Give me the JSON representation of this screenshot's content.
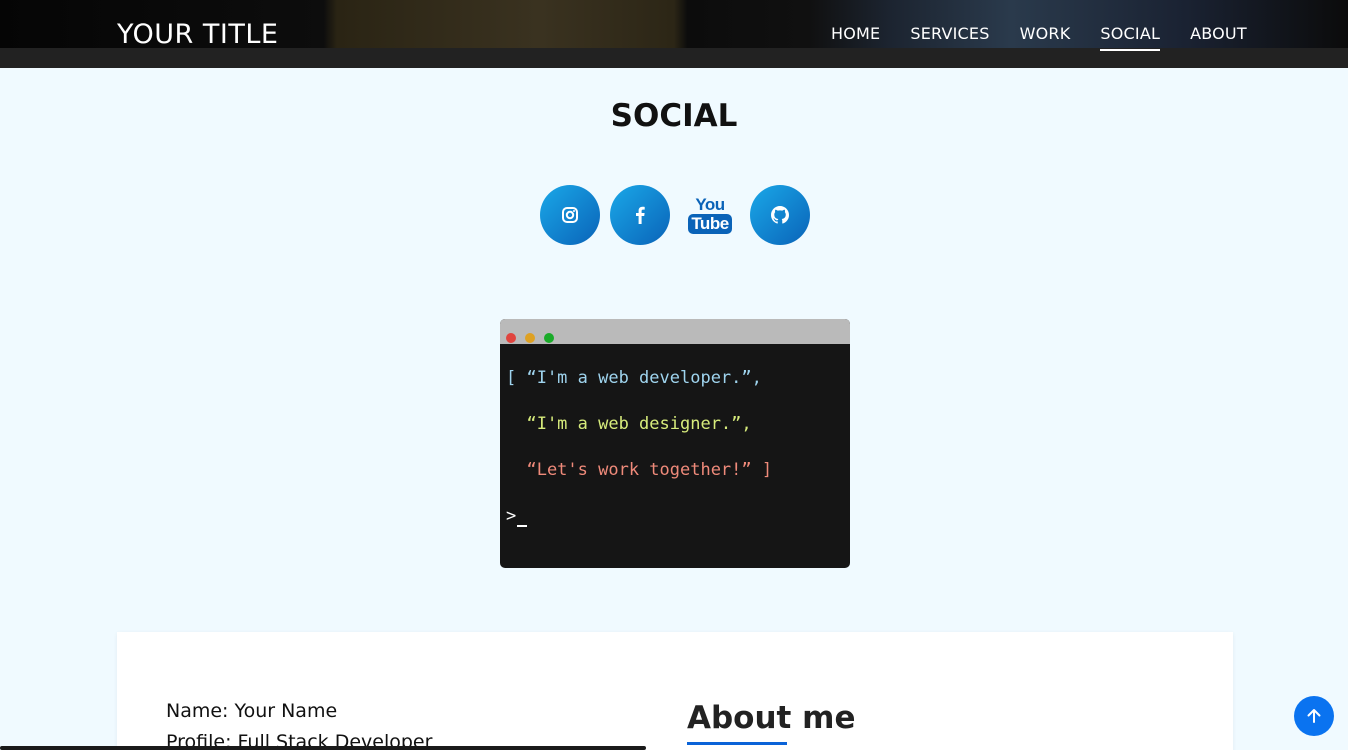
{
  "header": {
    "title": "YOUR TITLE",
    "nav": [
      {
        "label": "HOME",
        "active": false
      },
      {
        "label": "SERVICES",
        "active": false
      },
      {
        "label": "WORK",
        "active": false
      },
      {
        "label": "SOCIAL",
        "active": true
      },
      {
        "label": "ABOUT",
        "active": false
      }
    ]
  },
  "social": {
    "title": "SOCIAL",
    "icons": [
      "instagram-icon",
      "facebook-icon",
      "youtube-icon",
      "github-icon"
    ],
    "youtube_logo": {
      "top": "You",
      "bottom": "Tube"
    }
  },
  "terminal": {
    "lines": [
      "[ “I'm a web developer.”,",
      "  “I'm a web designer.”,",
      "  “Let's work together!” ]"
    ],
    "prompt": ">"
  },
  "about": {
    "name_line": "Name: Your Name",
    "profile_line": "Profile: Full Stack Developer",
    "title": "About me"
  },
  "colors": {
    "accent": "#0a63b8",
    "back_to_top": "#0a73f0",
    "page_bg": "#f0faff",
    "terminal_line1": "#9fd4ee",
    "terminal_line2": "#d7ec7c",
    "terminal_line3": "#ef8a7a"
  },
  "back_to_top_icon": "arrow-up-icon"
}
